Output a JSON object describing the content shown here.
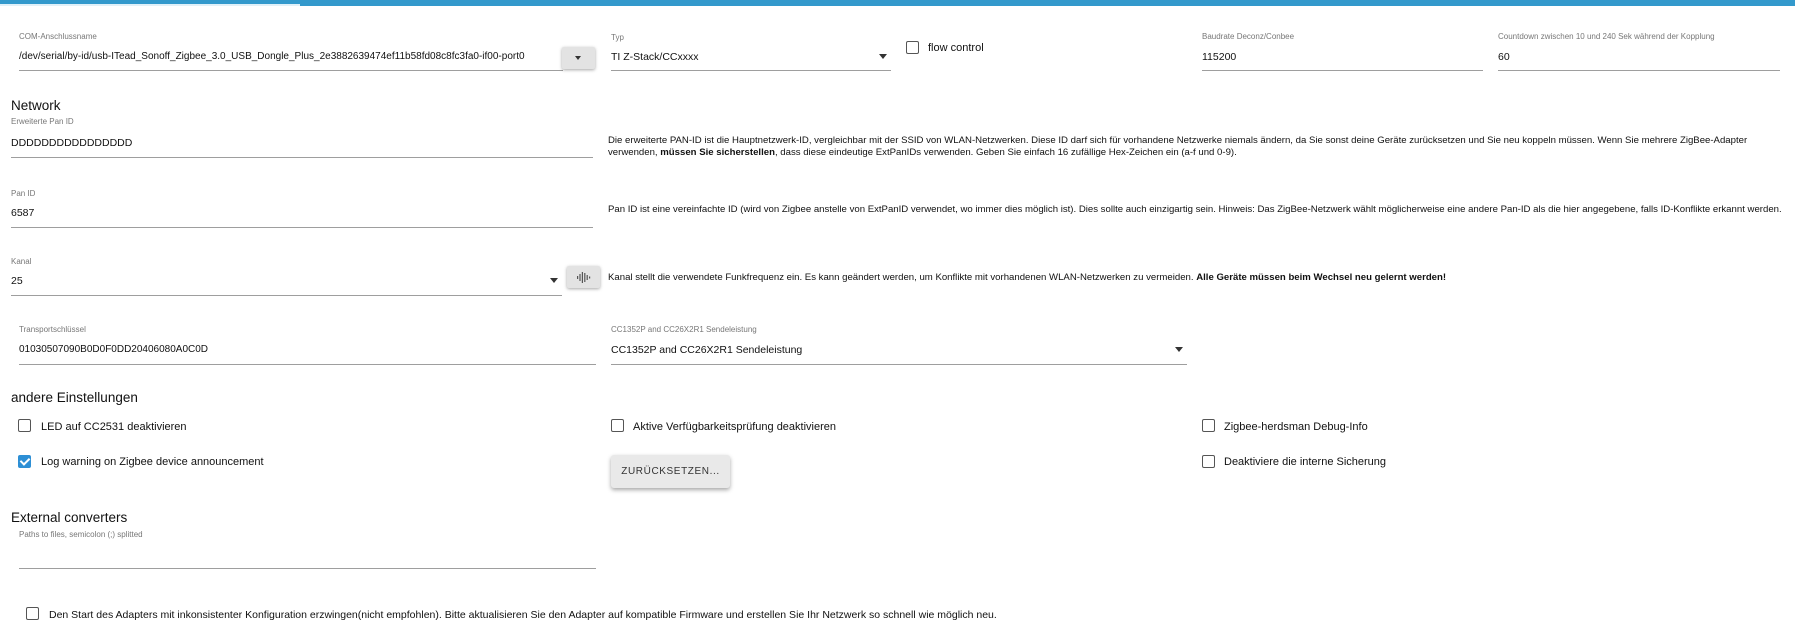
{
  "port": {
    "label": "COM-Anschlussname",
    "value": "/dev/serial/by-id/usb-ITead_Sonoff_Zigbee_3.0_USB_Dongle_Plus_2e3882639474ef11b58fd08c8fc3fa0-if00-port0"
  },
  "type": {
    "label": "Typ",
    "value": "TI Z-Stack/CCxxxx"
  },
  "flow_control": {
    "label": "flow control",
    "checked": false
  },
  "baudrate": {
    "label": "Baudrate Deconz/Conbee",
    "value": "115200"
  },
  "countdown": {
    "label": "Countdown zwischen 10 und 240 Sek während der Kopplung",
    "value": "60"
  },
  "network": {
    "heading": "Network",
    "ext_pan_id": {
      "label": "Erweiterte Pan ID",
      "value": "DDDDDDDDDDDDDDDD",
      "desc_line1": "Die erweiterte PAN-ID ist die Hauptnetzwerk-ID, vergleichbar mit der SSID von WLAN-Netzwerken. Diese ID darf sich für vorhandene Netzwerke niemals ändern, da Sie sonst deine Geräte zurücksetzen und Sie neu koppeln müssen. Wenn Sie mehrere ZigBee-Adapter verwenden,",
      "desc_bold": "müssen Sie sicherstellen",
      "desc_line2": ", dass diese eindeutige ExtPanIDs verwenden. Geben Sie einfach 16 zufällige Hex-Zeichen ein (a-f und 0-9)."
    },
    "pan_id": {
      "label": "Pan ID",
      "value": "6587",
      "desc": "Pan ID ist eine vereinfachte ID (wird von Zigbee anstelle von ExtPanID verwendet, wo immer dies möglich ist). Dies sollte auch einzigartig sein. Hinweis: Das ZigBee-Netzwerk wählt möglicherweise eine andere Pan-ID als die hier angegebene, falls ID-Konflikte erkannt werden."
    },
    "channel": {
      "label": "Kanal",
      "value": "25",
      "desc": "Kanal stellt die verwendete Funkfrequenz ein. Es kann geändert werden, um Konflikte mit vorhandenen WLAN-Netzwerken zu vermeiden.",
      "desc_bold": "Alle Geräte müssen beim Wechsel neu gelernt werden!"
    },
    "transport_key": {
      "label": "Transportschlüssel",
      "value": "01030507090B0D0F0DD20406080A0C0D"
    },
    "tx_power": {
      "label": "CC1352P and CC26X2R1 Sendeleistung",
      "value": "CC1352P and CC26X2R1 Sendeleistung"
    }
  },
  "other": {
    "heading": "andere Einstellungen",
    "led": {
      "label": "LED auf CC2531 deaktivieren",
      "checked": false
    },
    "availability": {
      "label": "Aktive Verfügbarkeitsprüfung deaktivieren",
      "checked": false
    },
    "debug": {
      "label": "Zigbee-herdsman Debug-Info",
      "checked": false
    },
    "log_warning": {
      "label": "Log warning on Zigbee device announcement",
      "checked": true
    },
    "reset_button": "ZURÜCKSETZEN...",
    "backup": {
      "label": "Deaktiviere die interne Sicherung",
      "checked": false
    }
  },
  "external": {
    "heading": "External converters",
    "placeholder": "Paths to files, semicolon (;) splitted",
    "value": ""
  },
  "force_start": {
    "label": "Den Start des Adapters mit inkonsistenter Konfiguration erzwingen(nicht empfohlen). Bitte aktualisieren Sie den Adapter auf kompatible Firmware und erstellen Sie Ihr Netzwerk so schnell wie möglich neu.",
    "checked": false
  },
  "colors": {
    "accent": "#3399cc",
    "checkbox": "#2d8fd5"
  }
}
